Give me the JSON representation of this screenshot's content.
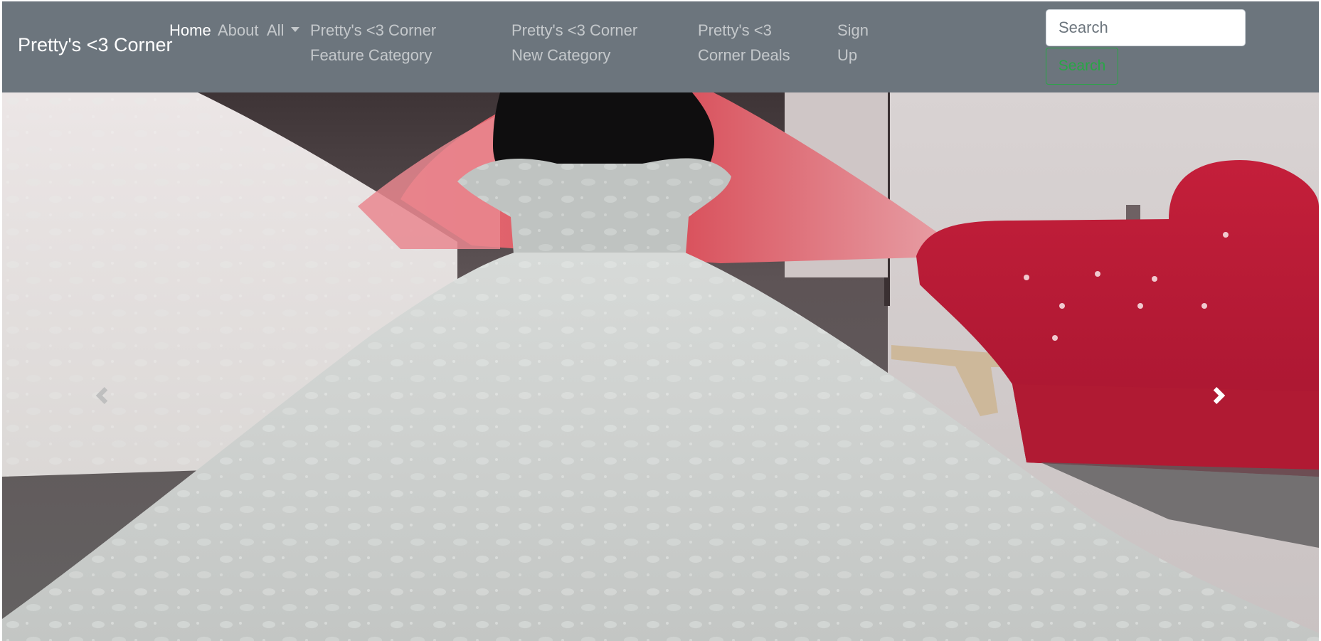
{
  "navbar": {
    "brand": "Pretty's <3 Corner",
    "links": [
      {
        "label": "Home",
        "active": true
      },
      {
        "label": "About",
        "active": false
      },
      {
        "label": "All",
        "active": false,
        "dropdown": true
      },
      {
        "label": "Pretty's <3 Corner Feature Category",
        "active": false
      },
      {
        "label": "Pretty's <3 Corner New Category",
        "active": false
      },
      {
        "label": "Pretty's <3 Corner Deals",
        "active": false
      },
      {
        "label": "Sign Up",
        "active": false
      }
    ],
    "search": {
      "placeholder": "Search",
      "button_label": "Search"
    }
  },
  "carousel": {
    "slide_alt": "White ball gown wedding dress on a mannequin in a bridal shop with a red tufted sofa",
    "prev_icon": "chevron-left-icon",
    "next_icon": "chevron-right-icon"
  },
  "colors": {
    "navbar_bg": "#6c757d",
    "brand_text": "#ffffff",
    "link_inactive": "rgba(255,255,255,0.6)",
    "search_button": "#28a745"
  }
}
